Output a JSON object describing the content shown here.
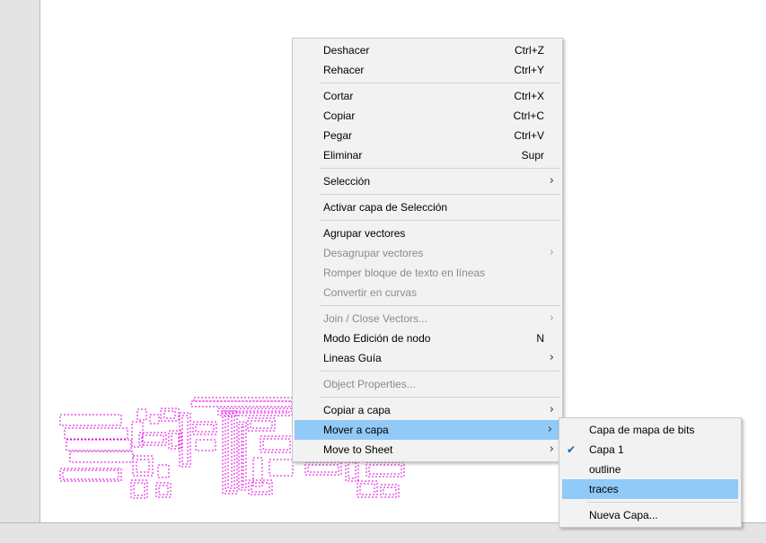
{
  "context_menu": {
    "undo": {
      "label": "Deshacer",
      "shortcut": "Ctrl+Z"
    },
    "redo": {
      "label": "Rehacer",
      "shortcut": "Ctrl+Y"
    },
    "cut": {
      "label": "Cortar",
      "shortcut": "Ctrl+X"
    },
    "copy": {
      "label": "Copiar",
      "shortcut": "Ctrl+C"
    },
    "paste": {
      "label": "Pegar",
      "shortcut": "Ctrl+V"
    },
    "delete": {
      "label": "Eliminar",
      "shortcut": "Supr"
    },
    "selection": {
      "label": "Selección"
    },
    "activate_selection_layer": {
      "label": "Activar capa de Selección"
    },
    "group_vectors": {
      "label": "Agrupar vectores"
    },
    "ungroup_vectors": {
      "label": "Desagrupar vectores"
    },
    "break_text_block": {
      "label": "Romper bloque de texto en líneas"
    },
    "convert_to_curves": {
      "label": "Convertir en curvas"
    },
    "join_close_vectors": {
      "label": "Join / Close Vectors..."
    },
    "node_edit_mode": {
      "label": "Modo Edición de nodo",
      "shortcut": "N"
    },
    "guide_lines": {
      "label": "Lineas Guía"
    },
    "object_properties": {
      "label": "Object Properties..."
    },
    "copy_to_layer": {
      "label": "Copiar a capa"
    },
    "move_to_layer": {
      "label": "Mover a capa"
    },
    "move_to_sheet": {
      "label": "Move to Sheet"
    }
  },
  "layer_submenu": {
    "items": [
      {
        "label": "Capa de mapa de bits"
      },
      {
        "label": "Capa 1",
        "checked": true
      },
      {
        "label": "outline"
      },
      {
        "label": "traces"
      }
    ],
    "new_layer": {
      "label": "Nueva Capa..."
    }
  },
  "icons": {
    "submenu_arrow": "chevron-right-icon",
    "check": "checkmark-icon"
  },
  "colors": {
    "highlight": "#91c9f7",
    "pcb_traces": "#e000e0",
    "menu_bg": "#f2f2f2"
  }
}
